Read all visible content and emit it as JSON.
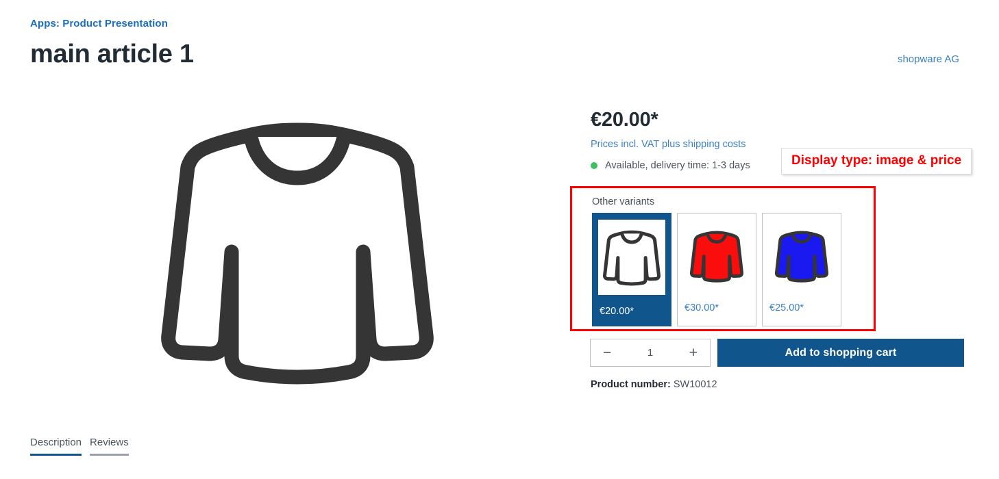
{
  "header": {
    "breadcrumb": "Apps: Product Presentation",
    "title": "main article 1",
    "manufacturer": "shopware AG"
  },
  "gallery": {
    "image_icon": "long-sleeve-shirt-placeholder",
    "image_alt": "main article 1 product image"
  },
  "buy": {
    "price": "€20.00*",
    "tax_info": "Prices incl. VAT plus shipping costs",
    "availability": "Available, delivery time: 1-3 days",
    "availability_color": "#3cc261",
    "quantity_value": "1",
    "decrease_label": "−",
    "increase_label": "+",
    "add_to_cart_label": "Add to shopping cart",
    "product_number_label": "Product number:",
    "product_number_value": "SW10012"
  },
  "variants": {
    "label": "Other variants",
    "items": [
      {
        "price": "€20.00*",
        "color": "#ffffff",
        "color_name": "white",
        "selected": true
      },
      {
        "price": "€30.00*",
        "color": "#fa0d0d",
        "color_name": "red",
        "selected": false
      },
      {
        "price": "€25.00*",
        "color": "#1a1af0",
        "color_name": "blue",
        "selected": false
      }
    ]
  },
  "annotation": {
    "text": "Display type: image & price",
    "color": "#ff0000"
  },
  "tabs": [
    {
      "label": "Description",
      "active": true
    },
    {
      "label": "Reviews",
      "active": false
    }
  ],
  "theme": {
    "brand_blue": "#10558c",
    "link_blue": "#3a7fc7",
    "text_dark": "#222c34",
    "text_body": "#4a545b",
    "border_gray": "#bcc1c7",
    "shirt_outline": "#353535"
  }
}
